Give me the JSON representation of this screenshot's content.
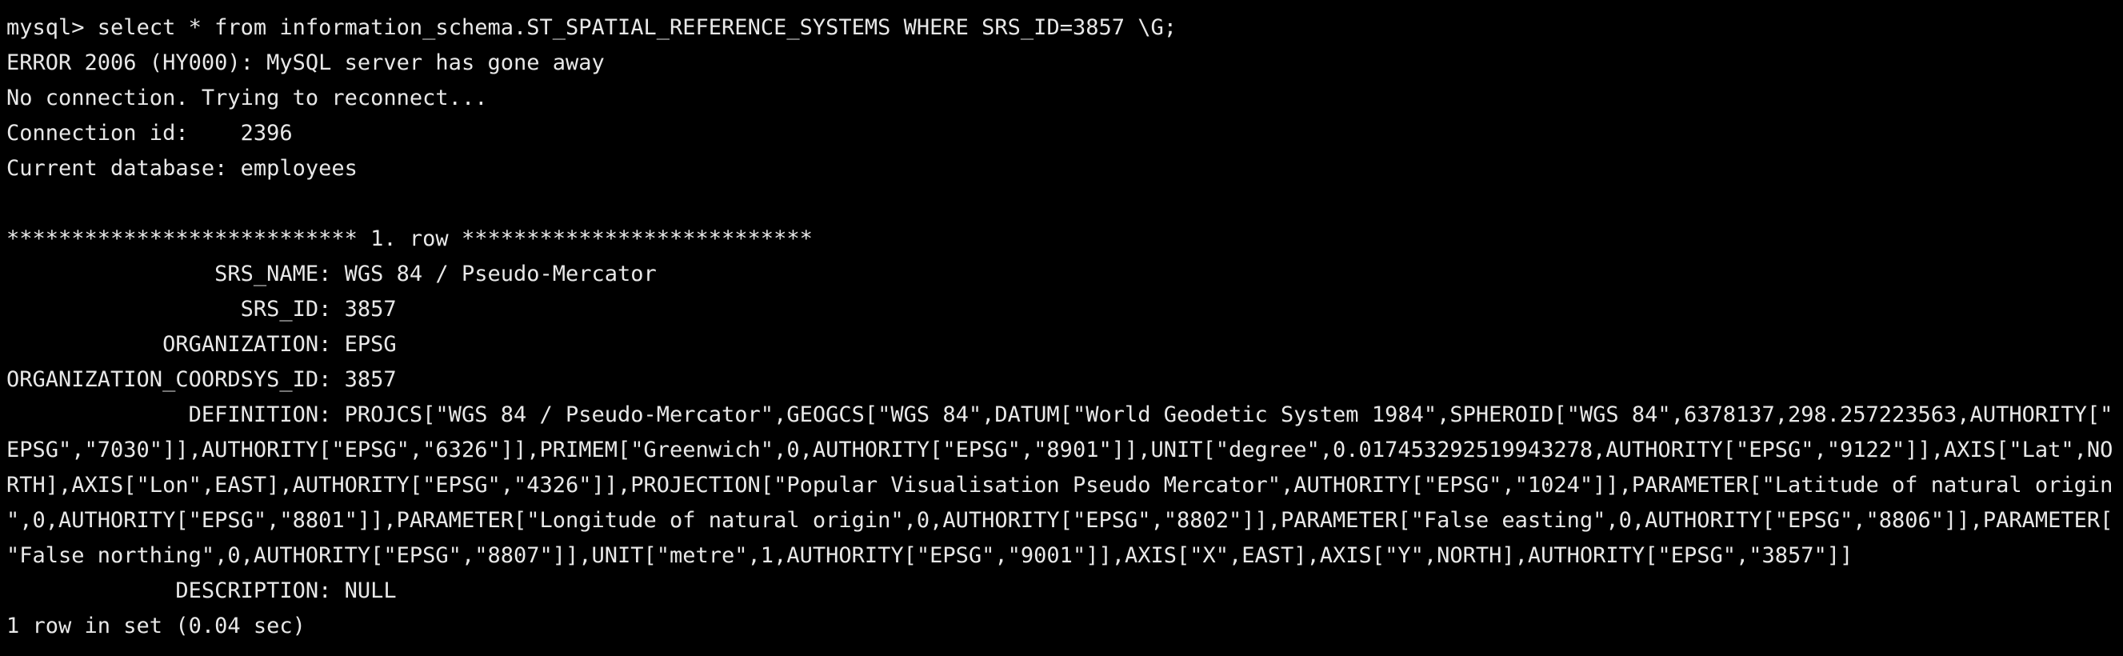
{
  "terminal": {
    "prompt": "mysql> ",
    "command": "select * from information_schema.ST_SPATIAL_REFERENCE_SYSTEMS WHERE SRS_ID=3857 \\G;",
    "error_line": "ERROR 2006 (HY000): MySQL server has gone away",
    "reconnect_line": "No connection. Trying to reconnect...",
    "connection_id_line": "Connection id:    2396",
    "current_db_line": "Current database: employees",
    "row_header": "*************************** 1. row ***************************",
    "fields": {
      "srs_name": "                SRS_NAME: WGS 84 / Pseudo-Mercator",
      "srs_id": "                  SRS_ID: 3857",
      "organization": "            ORGANIZATION: EPSG",
      "org_coordsys_id": "ORGANIZATION_COORDSYS_ID: 3857",
      "definition_lines": [
        "              DEFINITION: PROJCS[\"WGS 84 / Pseudo-Mercator\",GEOGCS[\"WGS 84\",DATUM[\"World Geodetic System 1984\",SPHEROID[\"WGS 84\",6378137,298.257223563,AUTHORITY[\"",
        "EPSG\",\"7030\"]],AUTHORITY[\"EPSG\",\"6326\"]],PRIMEM[\"Greenwich\",0,AUTHORITY[\"EPSG\",\"8901\"]],UNIT[\"degree\",0.017453292519943278,AUTHORITY[\"EPSG\",\"9122\"]],AXIS[\"Lat\",NO",
        "RTH],AXIS[\"Lon\",EAST],AUTHORITY[\"EPSG\",\"4326\"]],PROJECTION[\"Popular Visualisation Pseudo Mercator\",AUTHORITY[\"EPSG\",\"1024\"]],PARAMETER[\"Latitude of natural origin",
        "\",0,AUTHORITY[\"EPSG\",\"8801\"]],PARAMETER[\"Longitude of natural origin\",0,AUTHORITY[\"EPSG\",\"8802\"]],PARAMETER[\"False easting\",0,AUTHORITY[\"EPSG\",\"8806\"]],PARAMETER[",
        "\"False northing\",0,AUTHORITY[\"EPSG\",\"8807\"]],UNIT[\"metre\",1,AUTHORITY[\"EPSG\",\"9001\"]],AXIS[\"X\",EAST],AXIS[\"Y\",NORTH],AUTHORITY[\"EPSG\",\"3857\"]]"
      ],
      "description": "             DESCRIPTION: NULL"
    },
    "summary_line": "1 row in set (0.04 sec)"
  }
}
